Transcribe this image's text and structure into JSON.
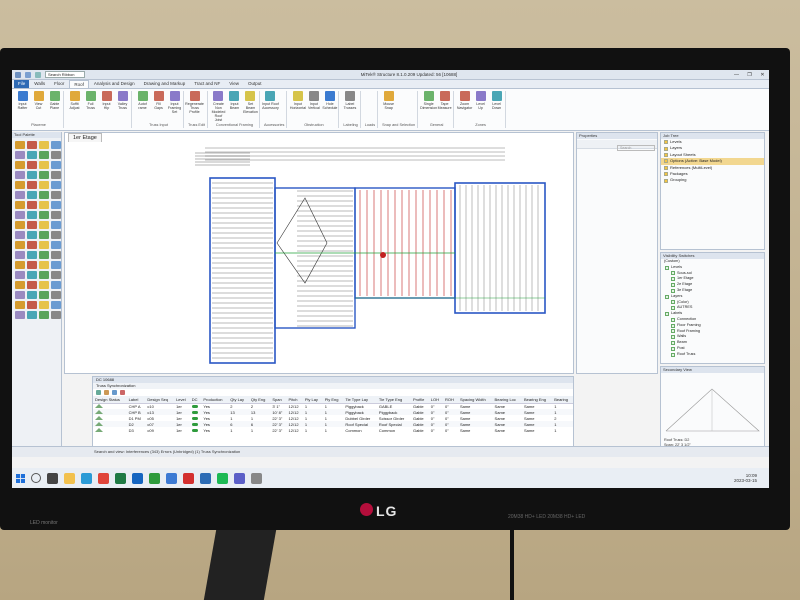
{
  "window": {
    "title": "MiTek® Structure 8.1.0.209 Updated: 56 [10688]",
    "search_placeholder": "Search Ribbon",
    "buttons": [
      "—",
      "❐",
      "✕"
    ]
  },
  "ribbon_tabs": [
    "File",
    "Walls",
    "Floor",
    "Roof",
    "Analysis and Design",
    "Drawing and Markup",
    "Tract and NF",
    "View",
    "Output"
  ],
  "ribbon": {
    "groups": [
      {
        "label": "Placeme",
        "buttons": [
          "Input Rafter",
          "View Cut",
          "Gable Plane"
        ]
      },
      {
        "label": "",
        "buttons": [
          "Soffit Adjust",
          "Full Truss",
          "Input Hip",
          "Valley Truss"
        ]
      },
      {
        "label": "Truss Input",
        "buttons": [
          "Autof rame",
          "Fill Gaps",
          "Input Framing Set"
        ]
      },
      {
        "label": "Truss Edit",
        "buttons": [
          "Regenerate Truss Profile"
        ]
      },
      {
        "label": "Conventional Framing",
        "buttons": [
          "Create Non Modeled Roof Joist",
          "Input Beam",
          "Set Beam Elevation"
        ]
      },
      {
        "label": "Accessories",
        "buttons": [
          "Input Roof Accessory"
        ]
      },
      {
        "label": "Obstruction",
        "buttons": [
          "Input Horizontal",
          "Input Vertical",
          "Hole Schedule"
        ]
      },
      {
        "label": "Labeling",
        "buttons": [
          "Label Trusses"
        ]
      },
      {
        "label": "Loads",
        "buttons": []
      },
      {
        "label": "Snap and Selection",
        "buttons": [
          "Mouse Snap"
        ]
      },
      {
        "label": "General",
        "buttons": [
          "Single Dimension",
          "Tape Measure"
        ]
      },
      {
        "label": "Zones",
        "buttons": [
          "Zoom Navigator",
          "Level Up",
          "Level Down"
        ]
      }
    ]
  },
  "tool_palette": {
    "title": "Tool Palette"
  },
  "drawing": {
    "tab_label": "1er Etage",
    "colors": {
      "wall": "#2a57c4",
      "truss": "#c22020",
      "dimension": "#555555",
      "beam": "#22a03a"
    }
  },
  "properties": {
    "title": "Properties",
    "search_placeholder": "Search"
  },
  "job_tree": {
    "title": "Job Tree",
    "items": [
      "Levels",
      "Layers",
      "Layout Sheets",
      "Options (Active: Base Model)",
      "References (MultiLevel)",
      "Packages",
      "Grouping"
    ],
    "highlighted": 3
  },
  "visibility": {
    "title": "Visibility Switches",
    "dropdown": "(Custom)",
    "items": [
      "Levels",
      "Sous-sol",
      "1er Etage",
      "2e Etage",
      "3e Etage",
      "Layers",
      "(Color)",
      "AUTRES",
      "Labels",
      "Connection",
      "Floor Framing",
      "Roof Framing",
      "Walls",
      "Beam",
      "Post",
      "Roof Truss"
    ]
  },
  "secondary_view": {
    "title": "Secondary View",
    "info": [
      "Roof Truss: D2",
      "Span: 22' 3 1/2\"",
      "Pitch: 12/12"
    ]
  },
  "bottom_panel": {
    "title": "DC 10688",
    "subtitle": "Truss Synchronization",
    "columns": [
      "Design Status",
      "Label",
      "Design Seq",
      "Level",
      "DC",
      "Production",
      "Qty Lay",
      "Qty Eng",
      "Span",
      "Pitch",
      "Ply Lay",
      "Ply Eng",
      "Tie Type Lay",
      "Tie Type Eng",
      "Profile",
      "LOH",
      "ROH",
      "Spacing Width",
      "Bearing Loc",
      "Bearing Eng",
      "Bearing"
    ],
    "rows": [
      [
        "",
        "CHP A",
        "c10",
        "1er",
        "",
        "Yes",
        "2",
        "2",
        "3' 1\"",
        "12/12",
        "1",
        "1",
        "Piggyback",
        "GABLE",
        "Gable",
        "0\"",
        "0\"",
        "Same",
        "Same",
        "Same",
        "1"
      ],
      [
        "",
        "CHP B",
        "c13",
        "1er",
        "",
        "Yes",
        "13",
        "13",
        "10' 8\"",
        "12/12",
        "1",
        "1",
        "Piggyback",
        "Piggyback",
        "Gable",
        "0\"",
        "0\"",
        "Same",
        "Same",
        "Same",
        "1"
      ],
      [
        "",
        "D1 PM",
        "c05",
        "1er",
        "",
        "Yes",
        "1",
        "1",
        "22' 3\"",
        "12/12",
        "1",
        "1",
        "Dubbel Girder",
        "Scissor Girder",
        "Gable",
        "0\"",
        "0\"",
        "Same",
        "Same",
        "Same",
        "2"
      ],
      [
        "",
        "D2",
        "c07",
        "1er",
        "",
        "Yes",
        "6",
        "6",
        "22' 3\"",
        "12/12",
        "1",
        "1",
        "Roof Special",
        "Roof Special",
        "Gable",
        "0\"",
        "0\"",
        "Same",
        "Same",
        "Same",
        "1"
      ],
      [
        "",
        "D3",
        "c09",
        "1er",
        "",
        "Yes",
        "1",
        "1",
        "22' 3\"",
        "12/12",
        "1",
        "1",
        "Common",
        "Common",
        "Gable",
        "0\"",
        "0\"",
        "Same",
        "Same",
        "Same",
        "1"
      ]
    ]
  },
  "statusbar": {
    "text": "Search and view: Interferences (343) Errors (Unbridged) (1)  Truss Synchronization"
  },
  "taskbar": {
    "time": "10:09",
    "date": "2023-03-15"
  },
  "monitor": {
    "brand": "LG",
    "left_label": "LED monitor",
    "right_label": "20M38  HD+  LED  20M38  HD+  LED"
  }
}
